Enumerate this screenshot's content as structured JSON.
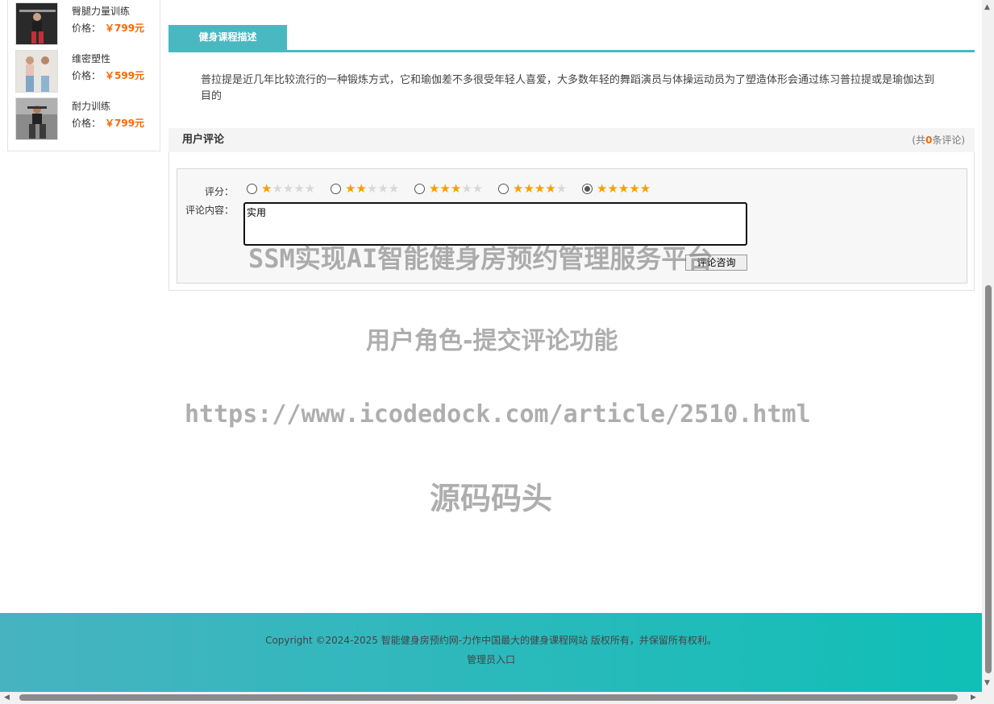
{
  "sidebar": {
    "products": [
      {
        "name": "臀腿力量训练",
        "price_label": "价格：",
        "price": "￥799元"
      },
      {
        "name": "维密塑性",
        "price_label": "价格：",
        "price": "￥599元"
      },
      {
        "name": "耐力训练",
        "price_label": "价格：",
        "price": "￥799元"
      }
    ]
  },
  "description": {
    "tab_label": "健身课程描述",
    "text": "普拉提是近几年比较流行的一种锻炼方式，它和瑜伽差不多很受年轻人喜爱，大多数年轻的舞蹈演员与体操运动员为了塑造体形会通过练习普拉提或是瑜伽达到目的"
  },
  "reviews": {
    "title": "用户评论",
    "count_prefix": "(共",
    "count": "0",
    "count_suffix": "条评论)",
    "rating_label": "评分：",
    "content_label": "评论内容：",
    "content_value": "实用",
    "submit_label": "评论咨询",
    "selected_rating": 5,
    "rating_options": [
      1,
      2,
      3,
      4,
      5
    ]
  },
  "watermark": {
    "line1": "SSM实现AI智能健身房预约管理服务平台",
    "line2": "用户角色-提交评论功能",
    "line3": "https://www.icodedock.com/article/2510.html",
    "line4": "源码码头"
  },
  "footer": {
    "copyright": "Copyright ©2024-2025 智能健身房预约网-力作中国最大的健身课程网站 版权所有，并保留所有权利。",
    "admin_link": "管理员入口"
  },
  "colors": {
    "accent": "#4ab8c1",
    "price": "#ff6600",
    "star": "#f5a000"
  }
}
